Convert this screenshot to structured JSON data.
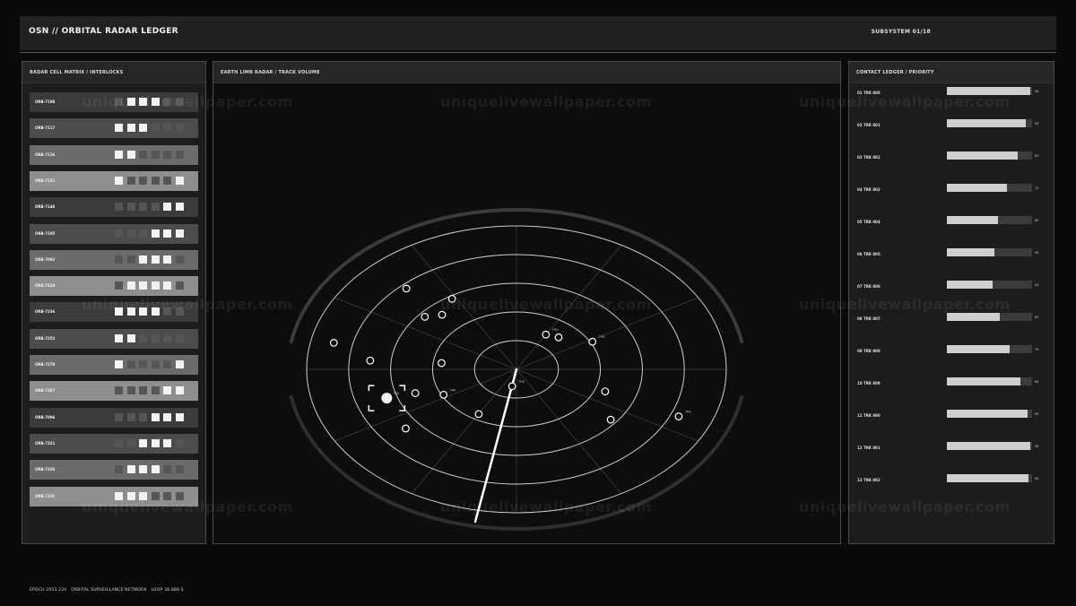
{
  "header": {
    "title": "OSN // ORBITAL RADAR LEDGER",
    "subsystem": "SUBSYSTEM 01/18"
  },
  "left_panel": {
    "title": "RADAR CELL MATRIX / INTERLOCKS",
    "rows": [
      {
        "id": "ORB-7198",
        "cells": [
          1,
          2,
          2,
          2,
          1,
          1
        ]
      },
      {
        "id": "ORB-7117",
        "cells": [
          2,
          2,
          2,
          1,
          1,
          1
        ]
      },
      {
        "id": "ORB-7126",
        "cells": [
          2,
          2,
          1,
          1,
          1,
          1
        ]
      },
      {
        "id": "ORB-7151",
        "cells": [
          2,
          1,
          1,
          1,
          1,
          2
        ]
      },
      {
        "id": "ORB-7148",
        "cells": [
          1,
          1,
          1,
          1,
          2,
          2
        ]
      },
      {
        "id": "ORB-7195",
        "cells": [
          1,
          1,
          1,
          2,
          2,
          2
        ]
      },
      {
        "id": "ORB-7092",
        "cells": [
          1,
          1,
          2,
          2,
          2,
          1
        ]
      },
      {
        "id": "ORB-7319",
        "cells": [
          1,
          2,
          2,
          2,
          2,
          1
        ]
      },
      {
        "id": "ORB-7236",
        "cells": [
          2,
          2,
          2,
          2,
          1,
          1
        ]
      },
      {
        "id": "ORB-7253",
        "cells": [
          2,
          2,
          1,
          1,
          1,
          1
        ]
      },
      {
        "id": "ORB-7278",
        "cells": [
          2,
          1,
          1,
          1,
          1,
          2
        ]
      },
      {
        "id": "ORB-7287",
        "cells": [
          1,
          1,
          1,
          1,
          2,
          2
        ]
      },
      {
        "id": "ORB-7096",
        "cells": [
          1,
          1,
          1,
          2,
          2,
          2
        ]
      },
      {
        "id": "ORB-7321",
        "cells": [
          1,
          1,
          2,
          2,
          2,
          1
        ]
      },
      {
        "id": "ORB-7336",
        "cells": [
          1,
          2,
          2,
          2,
          1,
          1
        ]
      },
      {
        "id": "ORB-7355",
        "cells": [
          2,
          2,
          2,
          1,
          1,
          1
        ]
      }
    ],
    "row_tones": [
      "#3a3b3a",
      "#4b4c4b",
      "#6a6b6a",
      "#8d8e8d"
    ]
  },
  "radar": {
    "title": "EARTH LIMB RADAR / TRACK VOLUME",
    "sweep_bearing_deg": 197,
    "tracks": [
      {
        "label": "",
        "r": 0.77,
        "a": 133
      },
      {
        "label": "",
        "r": 0.58,
        "a": 122
      },
      {
        "label": "",
        "r": 0.52,
        "a": 133
      },
      {
        "label": "",
        "r": 0.57,
        "a": 140
      },
      {
        "label": "",
        "r": 0.89,
        "a": 168
      },
      {
        "label": "",
        "r": 0.7,
        "a": 175
      },
      {
        "label": "",
        "r": 0.36,
        "a": 173
      },
      {
        "label": "TRK",
        "r": 0.65,
        "a": 198,
        "locked": true
      },
      {
        "label": "",
        "r": 0.51,
        "a": 199
      },
      {
        "label": "TRK",
        "r": 0.39,
        "a": 207
      },
      {
        "label": "",
        "r": 0.67,
        "a": 218
      },
      {
        "label": "",
        "r": 0.36,
        "a": 240
      },
      {
        "label": "TRK",
        "r": 0.12,
        "a": 260
      },
      {
        "label": "TRK",
        "r": 0.28,
        "a": 60
      },
      {
        "label": "",
        "r": 0.3,
        "a": 48
      },
      {
        "label": "TRK",
        "r": 0.41,
        "a": 28
      },
      {
        "label": "",
        "r": 0.45,
        "a": 340
      },
      {
        "label": "",
        "r": 0.57,
        "a": 322
      },
      {
        "label": "TRK",
        "r": 0.84,
        "a": 337
      }
    ]
  },
  "right_panel": {
    "title": "CONTACT LEDGER / PRIORITY",
    "rows": [
      {
        "label": "01  TRK 808",
        "value": 98
      },
      {
        "label": "02  TRK 801",
        "value": 93
      },
      {
        "label": "03  TRK 882",
        "value": 83
      },
      {
        "label": "04  TRK 802",
        "value": 71
      },
      {
        "label": "05  TRK 804",
        "value": 60
      },
      {
        "label": "06  TRK 805",
        "value": 56
      },
      {
        "label": "07  TRK 806",
        "value": 54
      },
      {
        "label": "08  TRK 807",
        "value": 62
      },
      {
        "label": "09  TRK 808",
        "value": 74
      },
      {
        "label": "10  TRK 809",
        "value": 86
      },
      {
        "label": "11  TRK 890",
        "value": 95
      },
      {
        "label": "12  TRK 891",
        "value": 98
      },
      {
        "label": "13  TRK 892",
        "value": 96
      }
    ]
  },
  "footer": {
    "text": "EPOCH 2053.224   ORBITAL SURVEILLANCE NETWORK   LOOP 38.888 S"
  },
  "watermark": {
    "text": "uniquelivewallpaper.com"
  },
  "colors": {
    "bg": "#0a0a0a",
    "panel": "#1b1c1b",
    "accent": "#ffffff",
    "cell_on": "#f2f2f2",
    "cell_off": "#555655"
  }
}
